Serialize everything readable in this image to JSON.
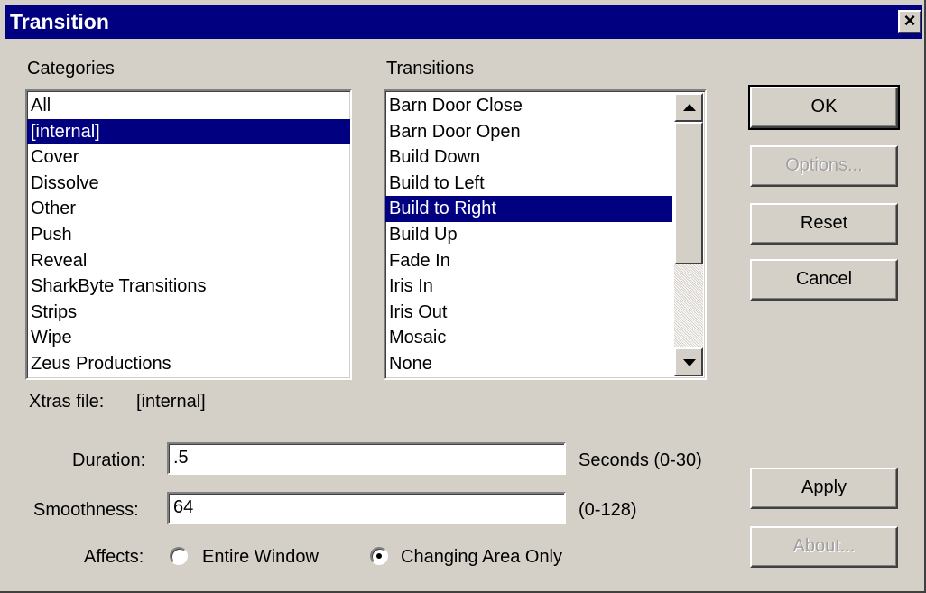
{
  "window": {
    "title": "Transition"
  },
  "categories": {
    "label": "Categories",
    "items": [
      "All",
      "[internal]",
      "Cover",
      "Dissolve",
      "Other",
      "Push",
      "Reveal",
      "SharkByte Transitions",
      "Strips",
      "Wipe",
      "Zeus Productions"
    ],
    "selected": "[internal]"
  },
  "transitions": {
    "label": "Transitions",
    "items": [
      "Barn Door Close",
      "Barn Door Open",
      "Build Down",
      "Build to Left",
      "Build to Right",
      "Build Up",
      "Fade In",
      "Iris In",
      "Iris Out",
      "Mosaic",
      "None"
    ],
    "selected": "Build to Right"
  },
  "buttons": {
    "ok": "OK",
    "options": "Options...",
    "reset": "Reset",
    "cancel": "Cancel",
    "apply": "Apply",
    "about": "About..."
  },
  "xtras": {
    "label": "Xtras file:",
    "value": "[internal]"
  },
  "duration": {
    "label": "Duration:",
    "value": ".5",
    "hint": "Seconds (0-30)"
  },
  "smoothness": {
    "label": "Smoothness:",
    "value": "64",
    "hint": "(0-128)"
  },
  "affects": {
    "label": "Affects:",
    "options": [
      "Entire Window",
      "Changing Area Only"
    ],
    "selected": "Changing Area Only"
  },
  "colors": {
    "titlebar": "#000080",
    "selection": "#000080",
    "face": "#d4d0c8"
  },
  "icons": {
    "close": "close-icon",
    "scroll_up": "scroll-up-icon",
    "scroll_down": "scroll-down-icon"
  }
}
